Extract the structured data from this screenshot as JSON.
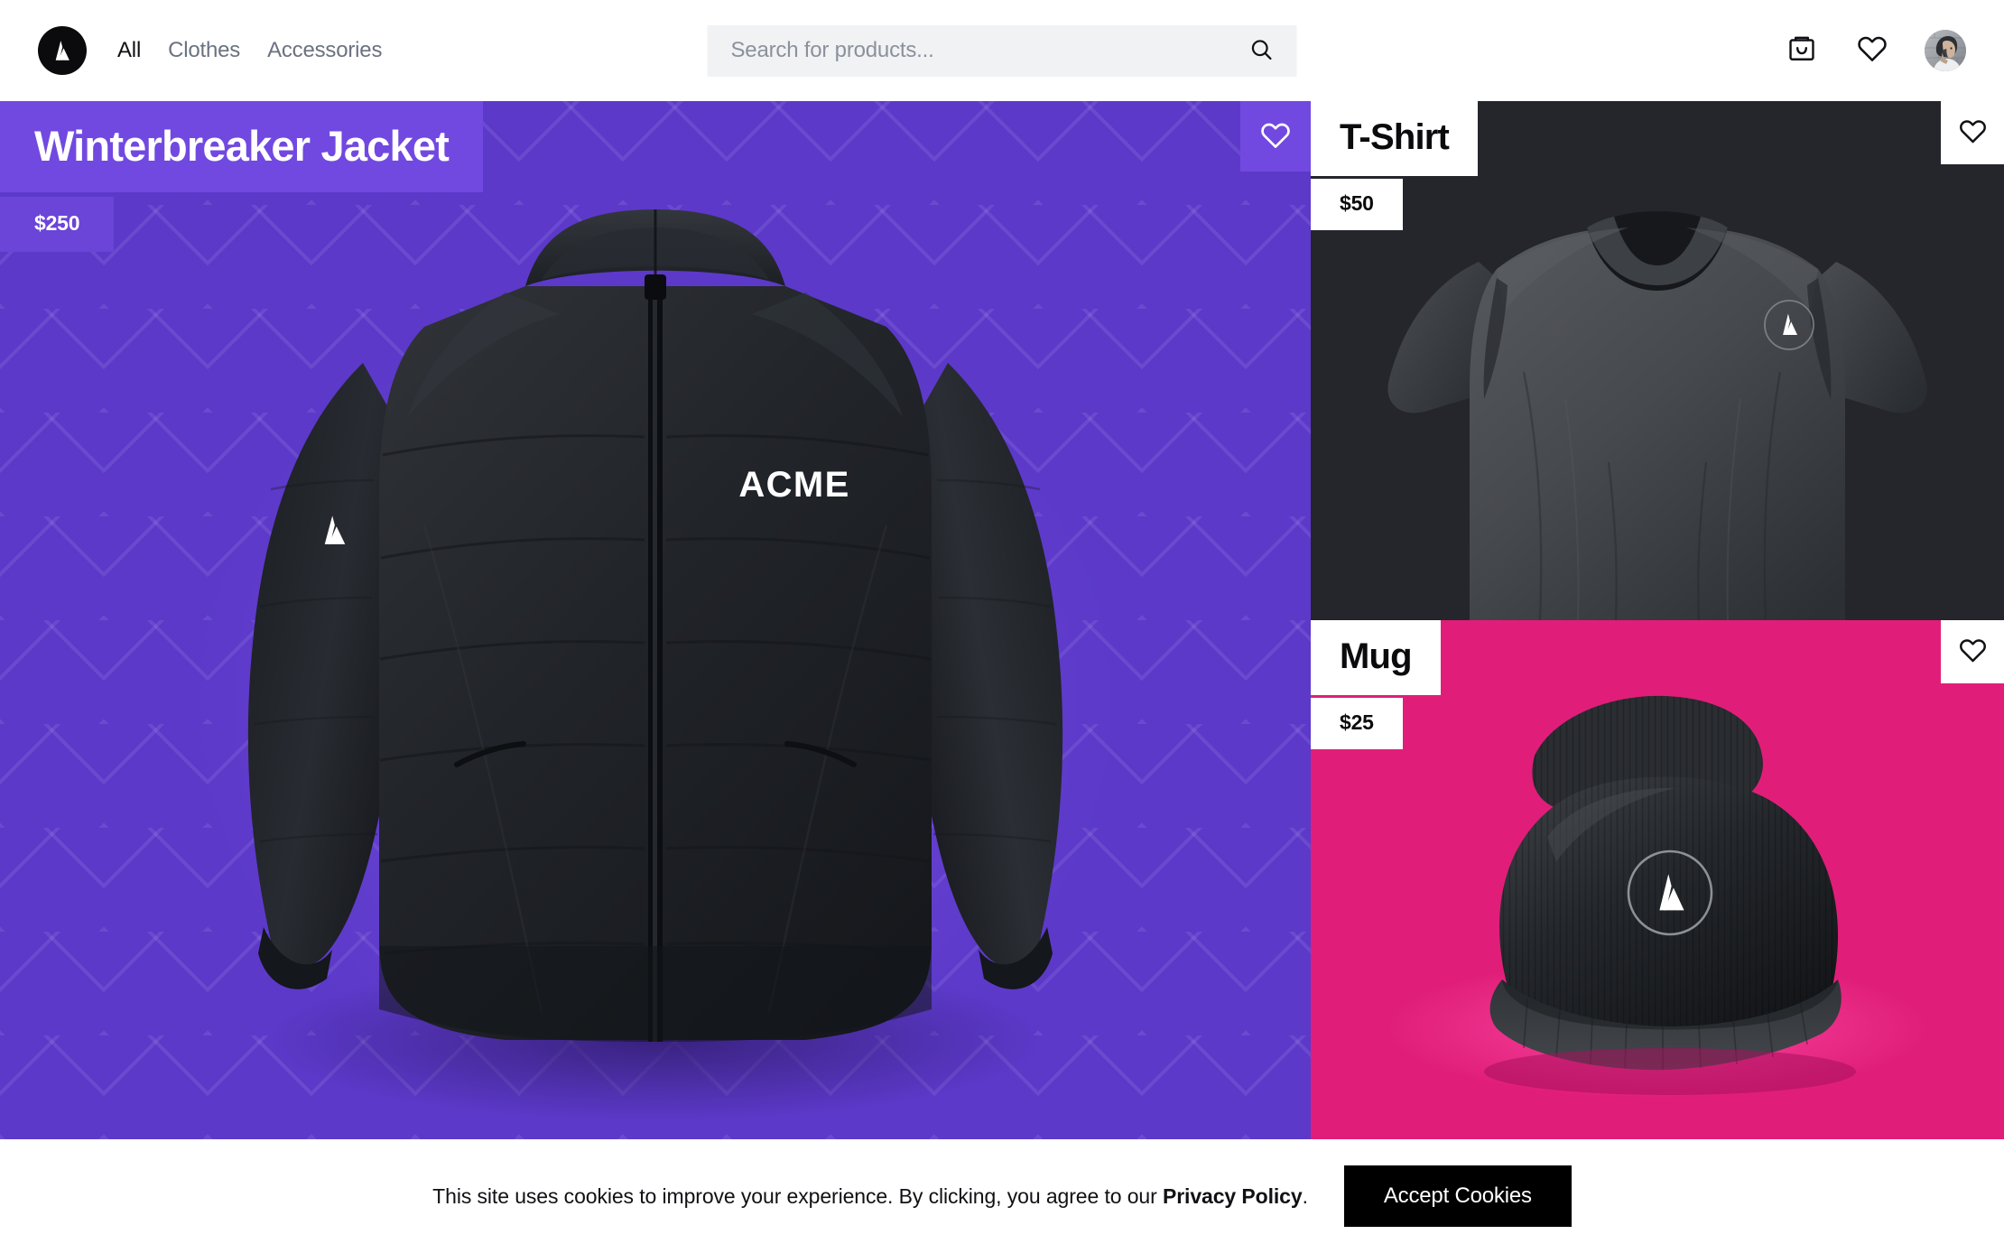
{
  "brand": {
    "name": "ACME",
    "logo_icon": "acme-triangle-logo"
  },
  "header": {
    "nav": [
      {
        "label": "All",
        "active": true
      },
      {
        "label": "Clothes",
        "active": false
      },
      {
        "label": "Accessories",
        "active": false
      }
    ],
    "search": {
      "placeholder": "Search for products...",
      "value": "",
      "icon": "search-icon"
    },
    "actions": [
      {
        "icon": "shopping-bag-icon",
        "label": "Cart"
      },
      {
        "icon": "heart-icon",
        "label": "Wishlist"
      },
      {
        "icon": "avatar",
        "label": "Account"
      }
    ]
  },
  "hero": {
    "title": "Winterbreaker Jacket",
    "price": "$250",
    "bg_color": "#5C39C9",
    "label_color": "#7149E0",
    "fav_icon": "heart-icon",
    "product_logo_text": "ACME",
    "product_sleeve_icon": "acme-triangle-logo"
  },
  "cards": [
    {
      "title": "T-Shirt",
      "price": "$50",
      "bg_color": "#24262C",
      "fav_icon": "heart-icon",
      "badge_icon": "acme-circle-logo"
    },
    {
      "title": "Mug",
      "price": "$25",
      "bg_color": "#E01E79",
      "fav_icon": "heart-icon",
      "badge_icon": "acme-circle-logo"
    }
  ],
  "cookie_banner": {
    "text_before": "This site uses cookies to improve your experience. By clicking, you agree to our ",
    "link": "Privacy Policy",
    "text_after": ".",
    "button_label": "Accept Cookies"
  }
}
